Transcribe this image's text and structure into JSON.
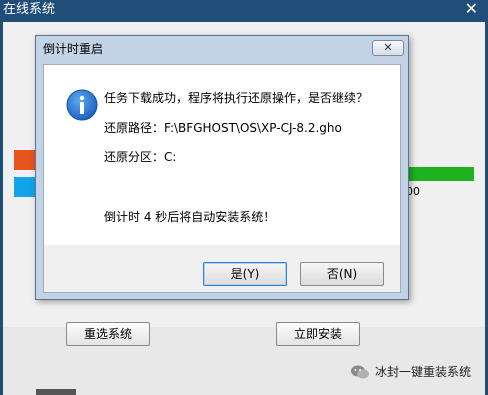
{
  "app": {
    "title": "在线系统",
    "close_glyph": "✕",
    "progress_suffix": "00",
    "buttons": {
      "reselect": "重选系统",
      "install_now": "立即安装"
    }
  },
  "watermark": {
    "text": "冰封一键重装系统"
  },
  "dialog": {
    "title": "倒计时重启",
    "close_glyph": "✕",
    "icon": "info-icon",
    "messages": {
      "main": "任务下载成功，程序将执行还原操作，是否继续？",
      "restore_path": "还原路径：F:\\BFGHOST\\OS\\XP-CJ-8.2.gho",
      "restore_partition": "还原分区：C:",
      "countdown": "倒计时 4 秒后将自动安装系统！"
    },
    "buttons": {
      "yes": "是(Y)",
      "no": "否(N)"
    }
  },
  "colors": {
    "window_bg": "#1f4e79",
    "accent_orange": "#e8531f",
    "accent_blue": "#13a3e8",
    "progress_green": "#1fb21f",
    "info_icon_blue": "#1c6fd1"
  }
}
